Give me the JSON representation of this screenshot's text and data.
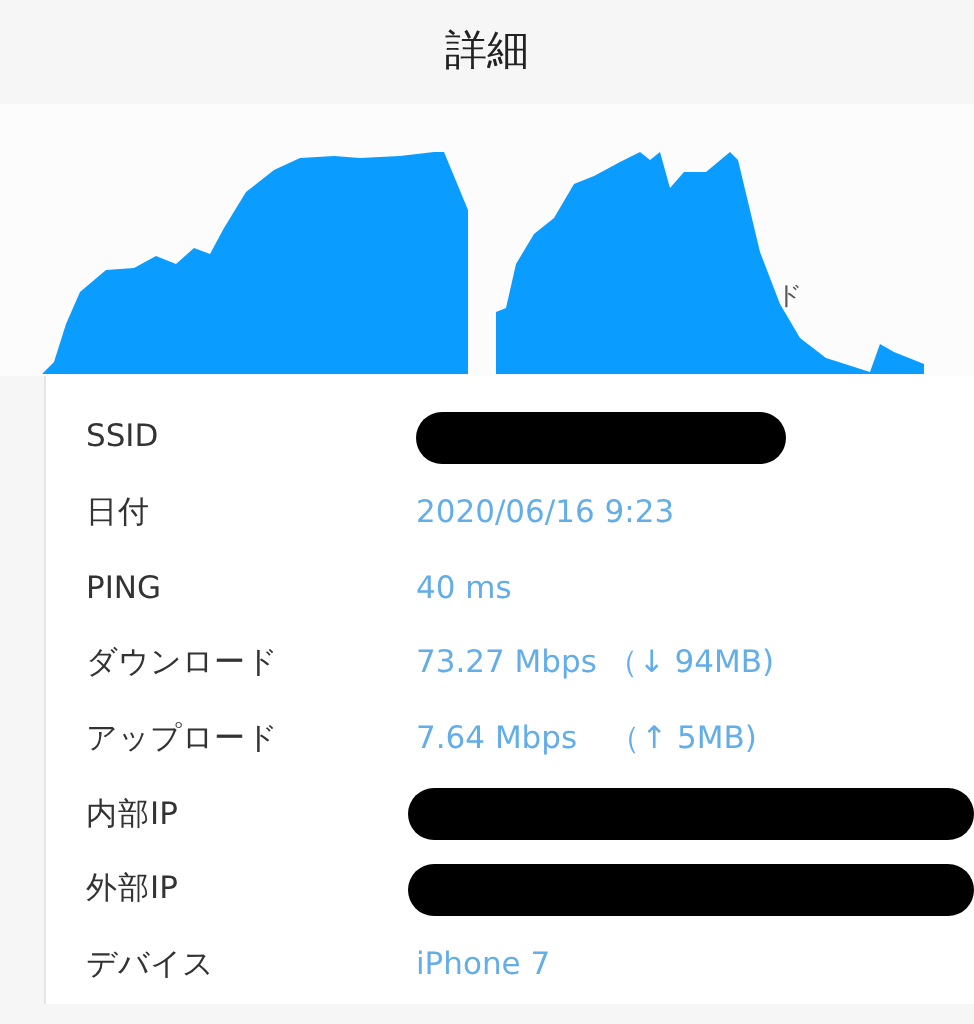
{
  "title": "詳細",
  "chart_overlay_text": "ド",
  "rows": [
    {
      "label": "SSID",
      "redacted": true
    },
    {
      "label": "日付",
      "value": "2020/06/16 9:23",
      "redacted": false
    },
    {
      "label": "PING",
      "value": "40 ms",
      "redacted": false
    },
    {
      "label": "ダウンロード",
      "value": "73.27 Mbps （↓ 94MB)",
      "redacted": false
    },
    {
      "label": "アップロード",
      "value": "7.64 Mbps　（↑ 5MB)",
      "redacted": false
    },
    {
      "label": "内部IP",
      "redacted": true
    },
    {
      "label": "外部IP",
      "redacted": true
    },
    {
      "label": "デバイス",
      "value": "iPhone 7",
      "redacted": false
    }
  ]
}
